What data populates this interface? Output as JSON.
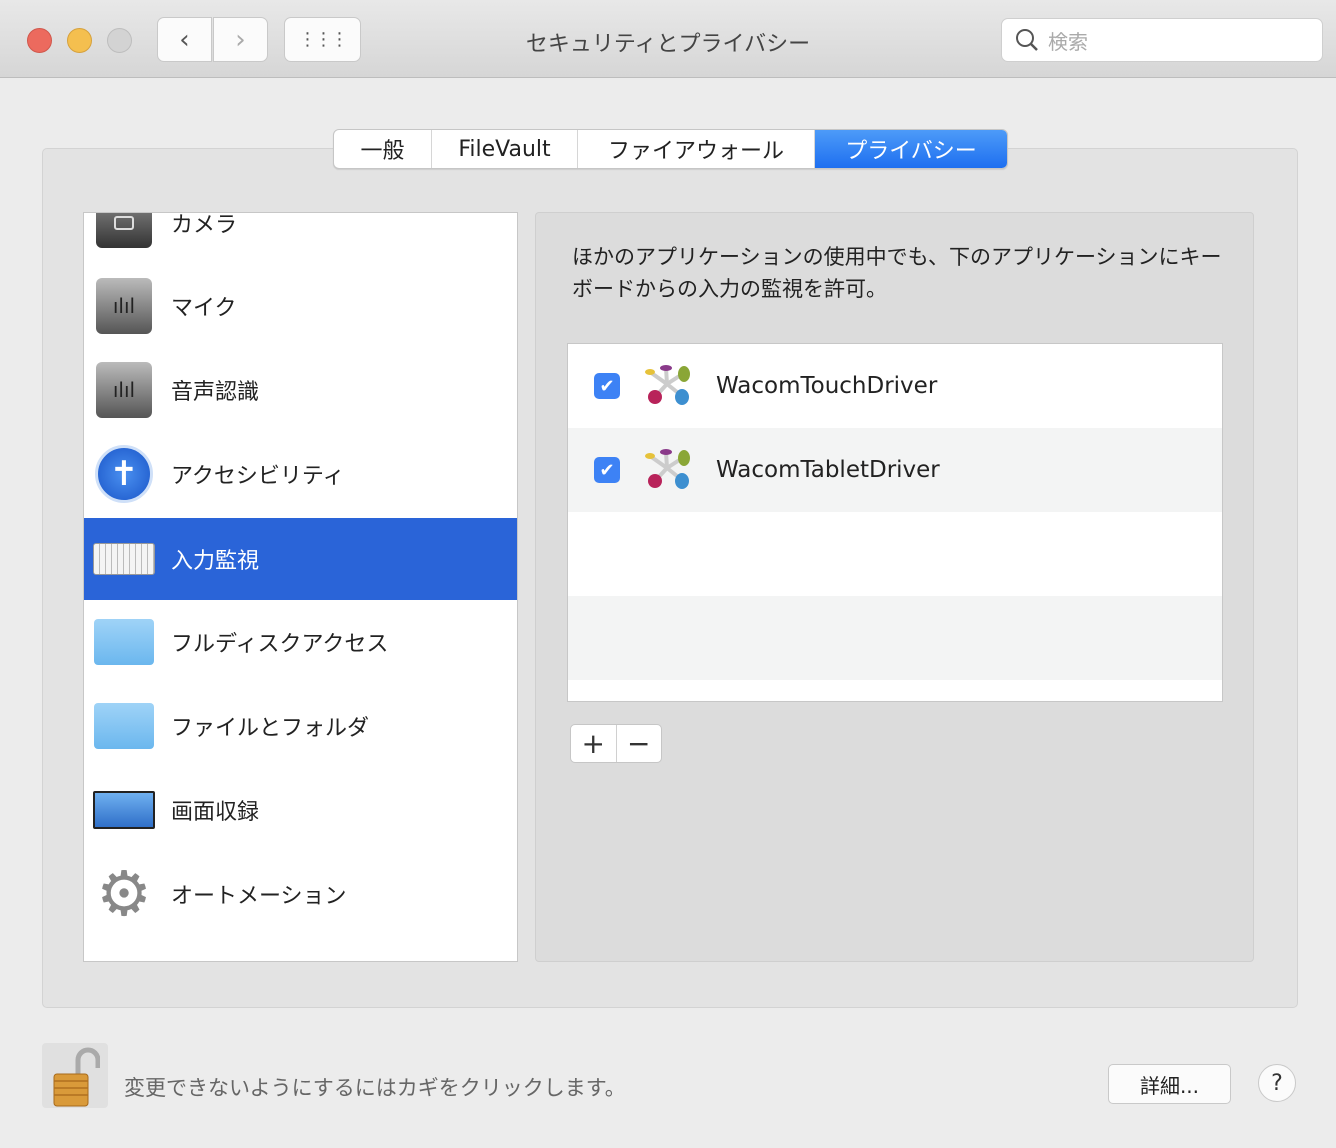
{
  "window": {
    "title": "セキュリティとプライバシー",
    "search_placeholder": "検索",
    "back": "‹",
    "forward": "›",
    "grid": "⋮⋮⋮"
  },
  "tabs": [
    {
      "label": "一般"
    },
    {
      "label": "FileVault"
    },
    {
      "label": "ファイアウォール"
    },
    {
      "label": "プライバシー",
      "selected": true
    }
  ],
  "sidebar": {
    "items": [
      {
        "label": "カメラ",
        "icon": "camera-icon"
      },
      {
        "label": "マイク",
        "icon": "microphone-icon"
      },
      {
        "label": "音声認識",
        "icon": "speech-recognition-icon"
      },
      {
        "label": "アクセシビリティ",
        "icon": "accessibility-icon"
      },
      {
        "label": "入力監視",
        "icon": "keyboard-icon",
        "selected": true
      },
      {
        "label": "フルディスクアクセス",
        "icon": "folder-icon"
      },
      {
        "label": "ファイルとフォルダ",
        "icon": "folder-icon"
      },
      {
        "label": "画面収録",
        "icon": "display-icon"
      },
      {
        "label": "オートメーション",
        "icon": "gear-icon"
      }
    ]
  },
  "main": {
    "description": "ほかのアプリケーションの使用中でも、下のアプリケーションにキーボードからの入力の監視を許可。",
    "apps": [
      {
        "name": "WacomTouchDriver",
        "checked": true
      },
      {
        "name": "WacomTabletDriver",
        "checked": true
      }
    ],
    "add": "+",
    "remove": "−"
  },
  "footer": {
    "lock_text": "変更できないようにするにはカギをクリックします。",
    "details": "詳細...",
    "help": "?"
  },
  "colors": {
    "accent": "#2a64d8",
    "checkbox": "#3d82f5"
  }
}
